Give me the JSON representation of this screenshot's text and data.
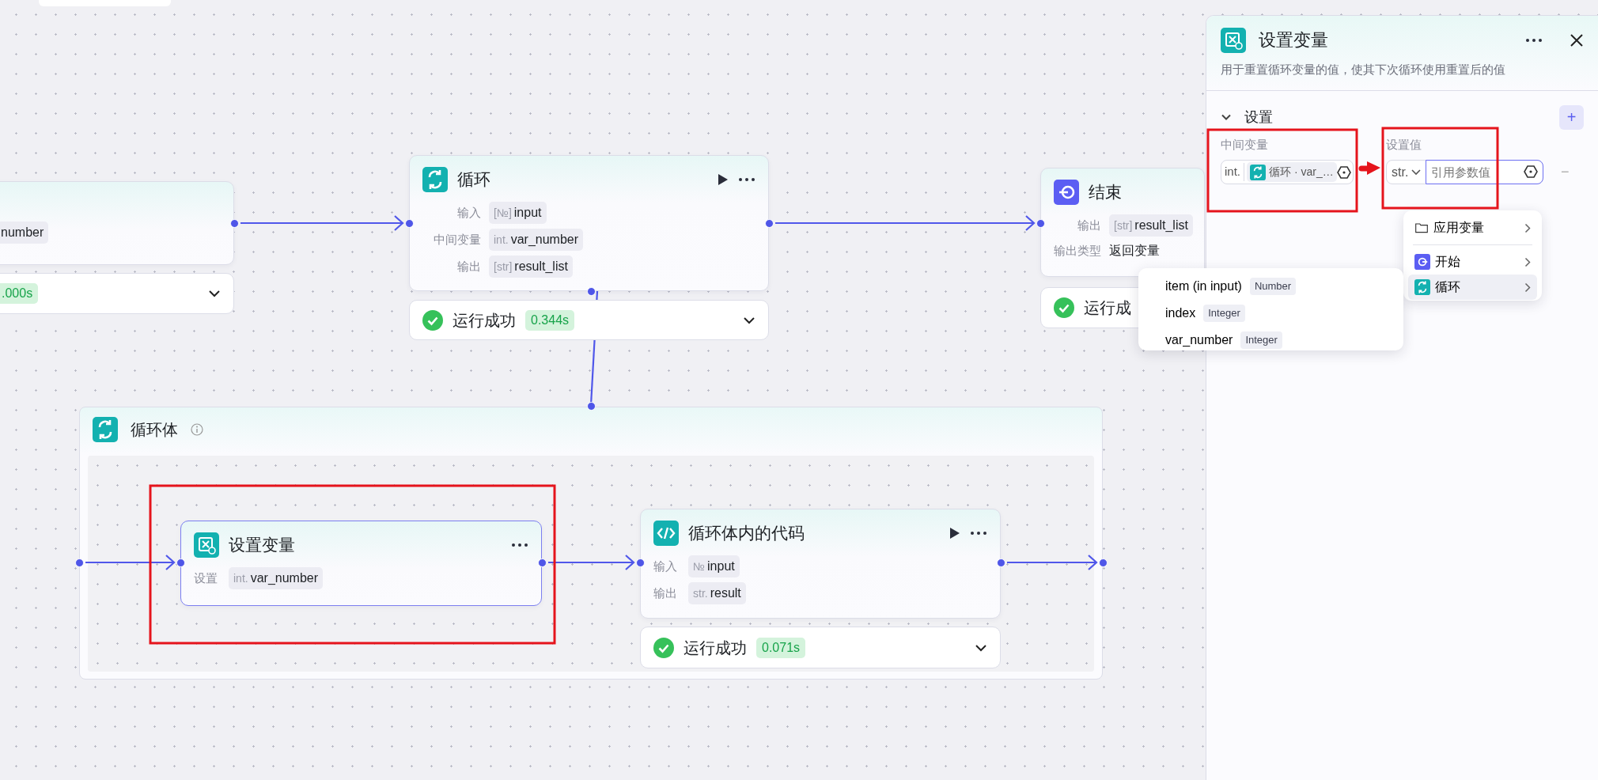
{
  "canvas": {
    "nodes": [
      {
        "kind": "cut",
        "selected": false,
        "fields": [
          {
            "value": "number"
          }
        ],
        "status": {
          "time": ".000s",
          "expanded": false
        }
      },
      {
        "kind": "loop",
        "title": "循环",
        "runnable": true,
        "selected": false,
        "fields": [
          {
            "label": "输入",
            "type": "[№]",
            "value": "input"
          },
          {
            "label": "中间变量",
            "type": "int.",
            "value": "var_number"
          },
          {
            "label": "输出",
            "type": "[str]",
            "value": "result_list"
          }
        ],
        "status": {
          "text": "运行成功",
          "time": "0.344s",
          "expanded": false
        }
      },
      {
        "kind": "end",
        "title": "结束",
        "selected": false,
        "fields": [
          {
            "label": "输出",
            "type": "[str]",
            "value": "result_list"
          },
          {
            "label": "输出类型",
            "value": "返回变量"
          }
        ],
        "status": {
          "text": "运行成"
        }
      }
    ],
    "loop_body": {
      "title": "循环体",
      "nodes": [
        {
          "kind": "setvar",
          "title": "设置变量",
          "selected": true,
          "fields": [
            {
              "label": "设置",
              "type": "int.",
              "value": "var_number"
            }
          ]
        },
        {
          "kind": "code",
          "title": "循环体内的代码",
          "runnable": true,
          "selected": false,
          "fields": [
            {
              "label": "输入",
              "type": "№",
              "value": "input"
            },
            {
              "label": "输出",
              "type": "str.",
              "value": "result"
            }
          ],
          "status": {
            "text": "运行成功",
            "time": "0.071s",
            "expanded": false
          }
        }
      ]
    }
  },
  "panel": {
    "title": "设置变量",
    "description": "用于重置循环变量的值，使其下次循环使用重置后的值",
    "section": {
      "title": "设置",
      "expanded": true,
      "add": "+",
      "columns": [
        "中间变量",
        "设置值"
      ],
      "rows": [
        {
          "type": "int.",
          "ref": "循环 · var_…",
          "value_type": "str.",
          "placeholder": "引用参数值",
          "remove": "−"
        }
      ]
    },
    "menu": {
      "items": [
        {
          "kind": "folder",
          "label": "应用变量",
          "selected": false
        },
        {
          "kind": "start",
          "label": "开始",
          "selected": false
        },
        {
          "kind": "loop",
          "label": "循环",
          "selected": true
        }
      ]
    },
    "submenu": {
      "items": [
        {
          "name": "item (in input)",
          "type": "Number"
        },
        {
          "name": "index",
          "type": "Integer"
        },
        {
          "name": "var_number",
          "type": "Integer"
        }
      ]
    }
  }
}
